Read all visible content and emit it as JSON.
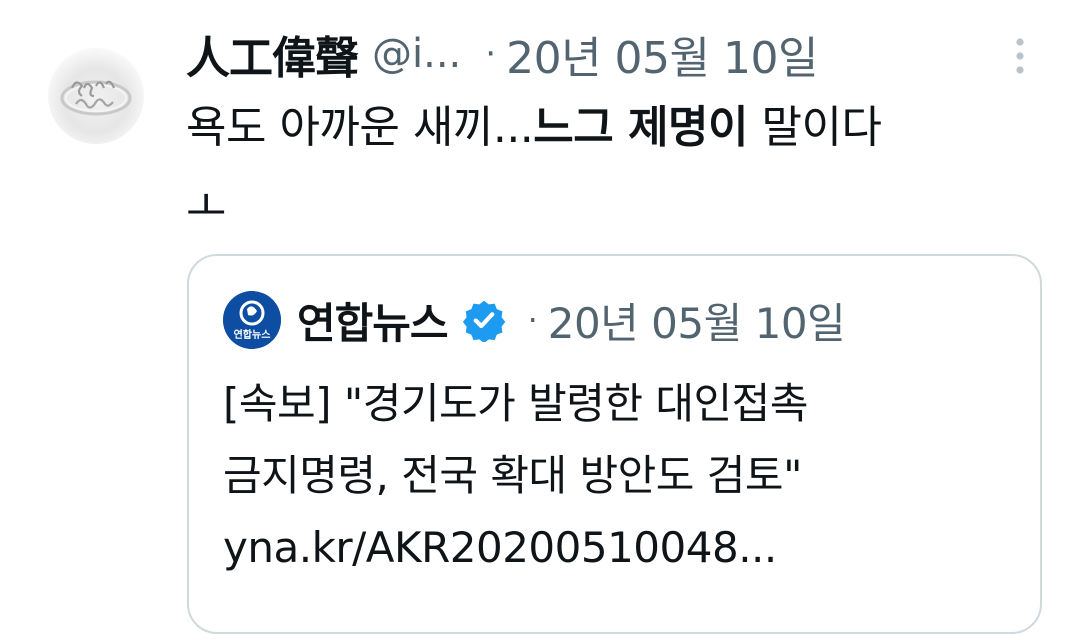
{
  "tweet": {
    "author_name": "人工偉聲",
    "author_handle": "@i...",
    "separator": "·",
    "date": "20년 05월 10일",
    "more_icon": "more-vertical-icon",
    "text": {
      "part1": "욕도 아까운 새끼...",
      "bold": "느그 제명이",
      "part2": " 말이다",
      "line2": "ㅗ"
    }
  },
  "quote": {
    "author_name": "연합뉴스",
    "avatar_text": "연합뉴스",
    "verified_icon": "verified-badge-icon",
    "separator": "·",
    "date": "20년 05월 10일",
    "lines": [
      "[속보] \"경기도가 발령한 대인접촉",
      "금지명령, 전국 확대 방안도 검토\"",
      "yna.kr/AKR20200510048..."
    ]
  },
  "colors": {
    "text": "#0f1419",
    "secondary": "#536471",
    "border": "#cfd9de",
    "verified": "#1d9bf0",
    "yonhap_blue": "#0d4ea3"
  }
}
